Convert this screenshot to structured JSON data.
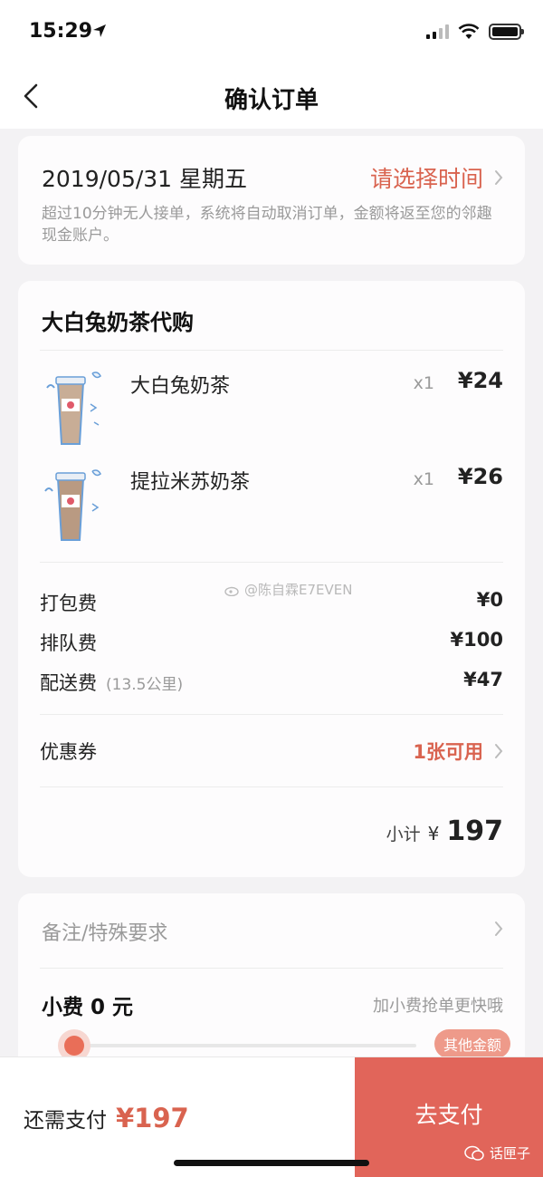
{
  "status_bar": {
    "time": "15:29"
  },
  "nav": {
    "title": "确认订单"
  },
  "delivery": {
    "date": "2019/05/31 星期五",
    "select_label": "请选择时间",
    "notice": "超过10分钟无人接单，系统将自动取消订单，金额将返至您的邻趣现金账户。"
  },
  "order": {
    "shop_name": "大白兔奶茶代购",
    "items": [
      {
        "name": "大白兔奶茶",
        "qty": "x1",
        "price": "¥24"
      },
      {
        "name": "提拉米苏奶茶",
        "qty": "x1",
        "price": "¥26"
      }
    ],
    "fees": [
      {
        "label": "打包费",
        "note": "",
        "value": "¥0"
      },
      {
        "label": "排队费",
        "note": "",
        "value": "¥100"
      },
      {
        "label": "配送费",
        "note": "(13.5公里)",
        "value": "¥47"
      }
    ],
    "coupon": {
      "label": "优惠券",
      "value": "1张可用"
    },
    "subtotal": {
      "label": "小计",
      "currency": "¥",
      "value": "197"
    }
  },
  "watermark": "@陈自霖E7EVEN",
  "extras": {
    "remark_placeholder": "备注/特殊要求",
    "tip_title": "小费 0 元",
    "tip_hint": "加小费抢单更快哦",
    "tip_level": 0,
    "other_amount": "其他金额"
  },
  "bottom": {
    "need_pay_label": "还需支付",
    "need_pay_value": "¥197",
    "pay_button": "去支付",
    "account_tag": "话匣子"
  },
  "colors": {
    "accent": "#d9634f",
    "pay_button": "#e1655a"
  }
}
